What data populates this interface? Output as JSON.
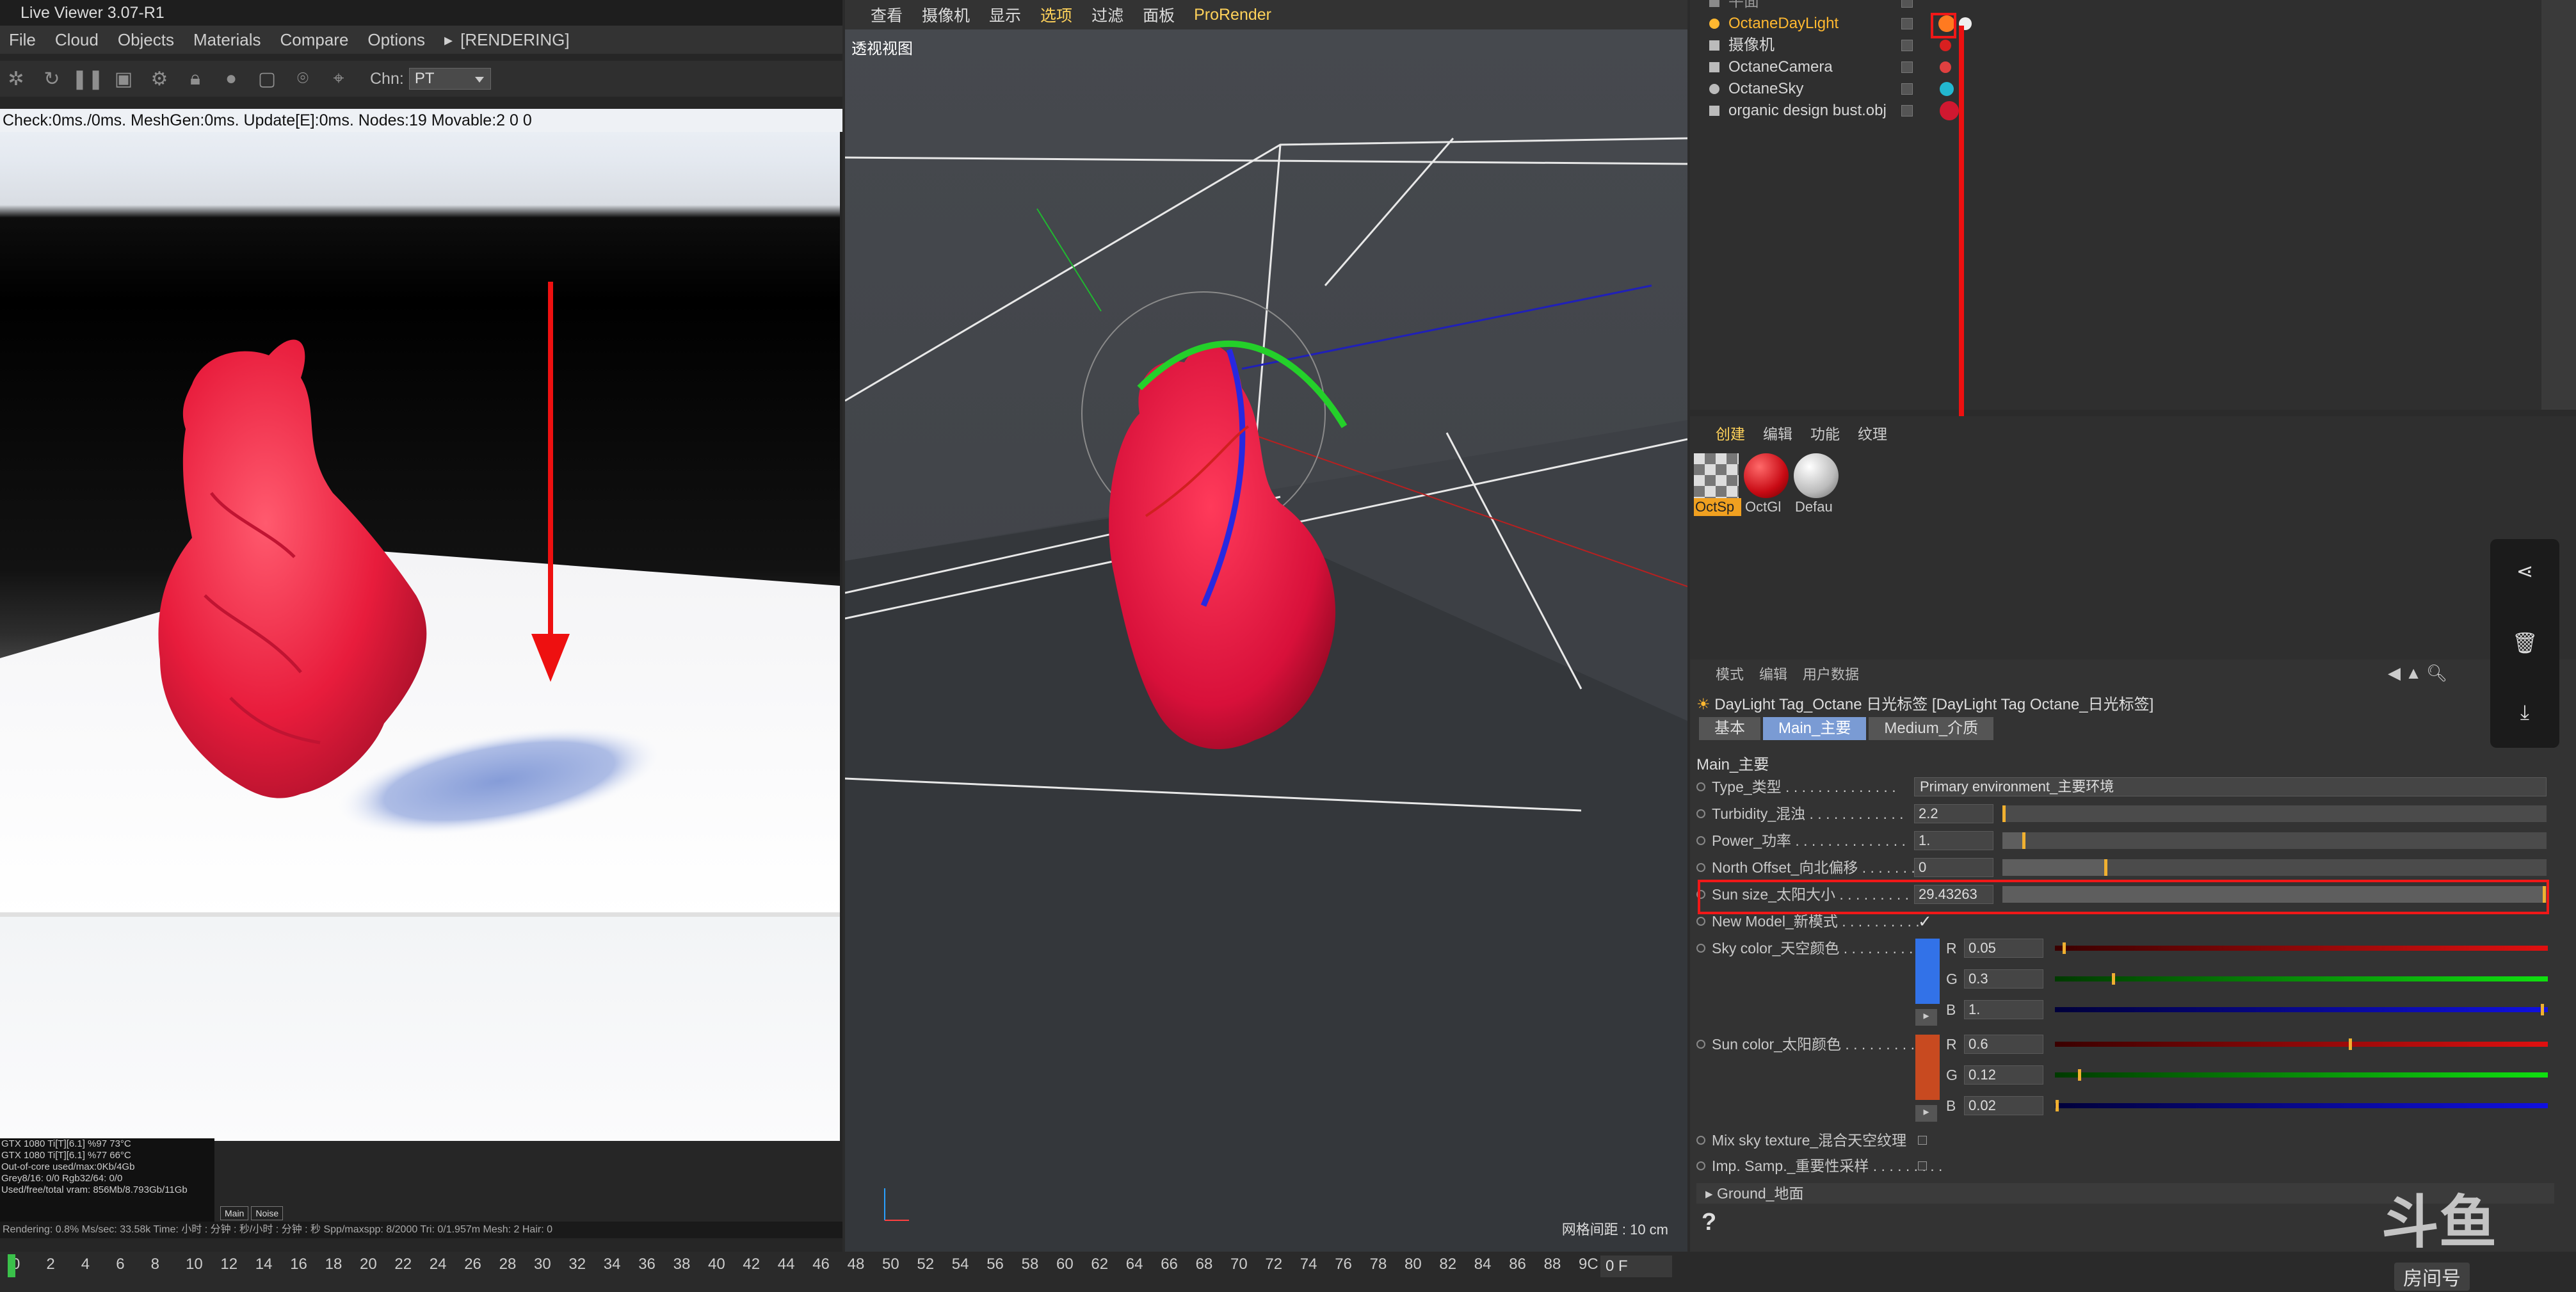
{
  "live_viewer": {
    "title": "Live Viewer 3.07-R1",
    "menu": [
      "File",
      "Cloud",
      "Objects",
      "Materials",
      "Compare",
      "Options",
      "[RENDERING]"
    ],
    "channel_label": "Chn:",
    "channel_value": "PT",
    "status": "Check:0ms./0ms. MeshGen:0ms. Update[E]:0ms. Nodes:19 Movable:2  0 0",
    "stats": [
      "GTX 1080 Ti[T][6.1]    %97   73°C",
      "GTX 1080 Ti[T][6.1]    %77   66°C",
      "Out-of-core used/max:0Kb/4Gb",
      "Grey8/16: 0/0          Rgb32/64: 0/0",
      "Used/free/total vram: 856Mb/8.793Gb/11Gb"
    ],
    "stat_buttons": [
      "Main",
      "Noise"
    ],
    "bottom": "Rendering: 0.8%   Ms/sec: 33.58k   Time: 小时 : 分钟 : 秒/小时 : 分钟 : 秒   Spp/maxspp: 8/2000   Tri: 0/1.957m  Mesh: 2    Hair: 0"
  },
  "viewport": {
    "menu": [
      "查看",
      "摄像机",
      "显示",
      "选项",
      "过滤",
      "面板",
      "ProRender"
    ],
    "active_menu": "选项",
    "label": "透视视图",
    "grid": "网格间距 : 10 cm"
  },
  "object_manager": {
    "rows": [
      {
        "name": "平面",
        "color": "#8a8a8a"
      },
      {
        "name": "OctaneDayLight",
        "color": "#ffb830",
        "tag": "#ff7a20"
      },
      {
        "name": "摄像机",
        "color": "#cccccc",
        "tag": "#d82020"
      },
      {
        "name": "OctaneCamera",
        "color": "#cccccc",
        "tag": "#e04040"
      },
      {
        "name": "OctaneSky",
        "color": "#cccccc",
        "tag": "#22b8d0"
      },
      {
        "name": "organic design bust.obj",
        "color": "#cccccc",
        "tag": "#d01830"
      }
    ]
  },
  "material_manager": {
    "tabs": [
      "创建",
      "编辑",
      "功能",
      "纹理"
    ],
    "materials": [
      {
        "name": "OctSp"
      },
      {
        "name": "OctGl"
      },
      {
        "name": "Defau"
      }
    ]
  },
  "attributes": {
    "top_tabs": [
      "模式",
      "编辑",
      "用户数据"
    ],
    "title": "DayLight Tag_Octane 日光标签 [DayLight Tag Octane_日光标签]",
    "tabs": [
      "基本",
      "Main_主要",
      "Medium_介质"
    ],
    "active_tab": "Main_主要",
    "section": "Main_主要",
    "params": [
      {
        "label": "Type_类型 . . . . . . . . . . . . . .",
        "select": "Primary environment_主要环境"
      },
      {
        "label": "Turbidity_混浊 . . . . . . . . . . . .",
        "value": "2.2",
        "fraction": 0.004
      },
      {
        "label": "Power_功率 . . . . . . . . . . . . . .",
        "value": "1.",
        "fraction": 0.04
      },
      {
        "label": "North Offset_向北偏移 . . . . . . . .",
        "value": "0",
        "fraction": 0.19
      },
      {
        "label": "Sun size_太阳大小 . . . . . . . . . .",
        "value": "29.43263",
        "fraction": 0.997
      },
      {
        "label": "New Model_新模式 . . . . . . . . . .",
        "check": "✓"
      }
    ],
    "sky_color_label": "Sky color_天空颜色 . . . . . . . . .",
    "sky_color": {
      "swatch": "#3272e8",
      "R": "0.05",
      "G": "0.3",
      "B": "1.",
      "r_frac": 0.02,
      "g_frac": 0.12,
      "b_frac": 0.99
    },
    "sun_color_label": "Sun color_太阳颜色 . . . . . . . . .",
    "sun_color": {
      "swatch": "#c84a20",
      "R": "0.6",
      "G": "0.12",
      "B": "0.02",
      "r_frac": 0.6,
      "g_frac": 0.05,
      "b_frac": 0.005
    },
    "extra_params": [
      "Mix sky texture_混合天空纹理",
      "Imp. Samp._重要性采样 . . . . . . . . ."
    ],
    "ground_label": "Ground_地面",
    "help": "?"
  },
  "timeline": {
    "ticks": [
      "0",
      "2",
      "4",
      "6",
      "8",
      "10",
      "12",
      "14",
      "16",
      "18",
      "20",
      "22",
      "24",
      "26",
      "28",
      "30",
      "32",
      "34",
      "36",
      "38",
      "40",
      "42",
      "44",
      "46",
      "48",
      "50",
      "52",
      "54",
      "56",
      "58",
      "60",
      "62",
      "64",
      "66",
      "68",
      "70",
      "72",
      "74",
      "76",
      "78",
      "80",
      "82",
      "84",
      "86",
      "88",
      "9C"
    ],
    "frame": "0 F"
  },
  "watermark": {
    "main": "斗鱼",
    "sub": "房间号"
  },
  "colors": {
    "highlight_red": "#f01818",
    "active_yellow": "#ffd25a"
  }
}
